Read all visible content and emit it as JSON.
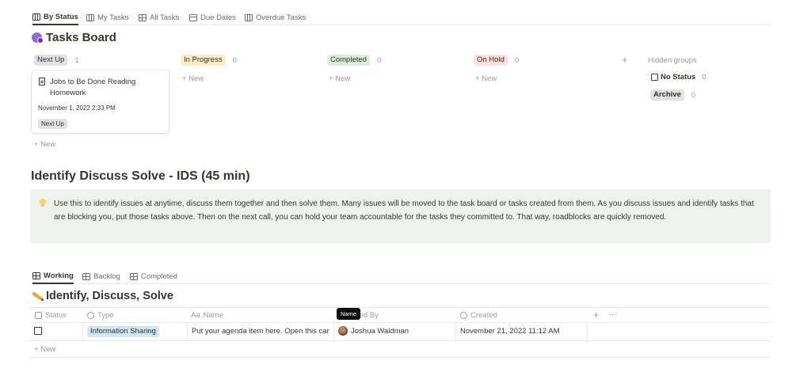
{
  "tabs": [
    {
      "label": "By Status"
    },
    {
      "label": "My Tasks"
    },
    {
      "label": "All Tasks"
    },
    {
      "label": "Due Dates"
    },
    {
      "label": "Overdue Tasks"
    }
  ],
  "board": {
    "title": "Tasks Board",
    "columns": [
      {
        "label": "Next Up",
        "count": "1",
        "bg": "#e3e2e0",
        "fg": "#32302c"
      },
      {
        "label": "In Progress",
        "count": "0",
        "bg": "#fdecc8",
        "fg": "#402c1b"
      },
      {
        "label": "Completed",
        "count": "0",
        "bg": "#dbeddb",
        "fg": "#1c3829"
      },
      {
        "label": "On Hold",
        "count": "0",
        "bg": "#ffe2dd",
        "fg": "#5d1715"
      }
    ],
    "add_label": "+",
    "hidden_groups_label": "Hidden groups",
    "hidden": [
      {
        "label": "No Status",
        "count": "0"
      },
      {
        "label": "Archive",
        "count": "0"
      }
    ],
    "new_label": "+ New",
    "card": {
      "title": "Jobs to Be Done Reading Homework",
      "date": "November 1, 2022 2:33 PM",
      "status": "Next Up"
    }
  },
  "ids": {
    "title": "Identify Discuss Solve - IDS (45 min)",
    "callout": "Use this to identify issues at anytime, discuss them together and then solve them. Many issues will be moved to the task board or tasks created from them. As you discuss issues and identify tasks that are blocking you, put those tasks above. Then on the next call, you can hold your team accountable for the tasks they committed to. That way, roadblocks are quickly removed."
  },
  "tabs2": [
    {
      "label": "Working"
    },
    {
      "label": "Backlog"
    },
    {
      "label": "Completed"
    }
  ],
  "table": {
    "title": "Identify, Discuss, Solve",
    "headers": {
      "status": "Status",
      "type": "Type",
      "name_prefix": "Aa",
      "name": "Name",
      "created_by": "ted By",
      "created": "Created",
      "add": "+",
      "more": "···"
    },
    "tooltip": "Name",
    "row": {
      "type": "Information Sharing",
      "name": "Put your agenda item here. Open this car",
      "person": "Joshua Waldman",
      "created": "November 21, 2022 11:12 AM"
    },
    "new_label": "+ New"
  },
  "colors": {
    "callout_bg": "#edf3ec",
    "type_pill_bg": "#d3e5ef"
  }
}
